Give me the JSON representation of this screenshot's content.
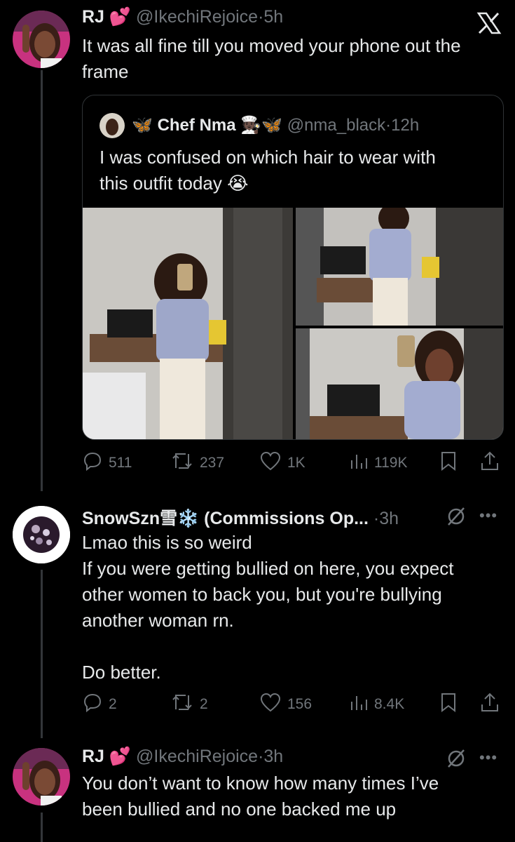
{
  "tweet1": {
    "name": "RJ",
    "name_emoji": "💕",
    "handle": "@IkechiRejoice",
    "sep": "·",
    "time": "5h",
    "text_line1": "It was all fine till you moved your phone out the",
    "text_line2": "frame",
    "x_logo_icon": "x-logo-icon",
    "quote": {
      "name": "Chef Nma",
      "handle": "@nma_black",
      "sep": "·",
      "time": "12h",
      "text_line1": "I was confused on which hair to wear with",
      "text_line2": "this outfit today 😭",
      "emojis_left": "🦋",
      "emojis_right": "🧑🏿‍🍳🦋"
    },
    "stats": {
      "replies": "511",
      "retweets": "237",
      "likes": "1K",
      "views": "119K"
    }
  },
  "tweet2": {
    "name": "SnowSzn雪❄️ (Commissions Op...",
    "sep": "·",
    "time": "3h",
    "text": [
      "Lmao this is so weird",
      "If you were getting bullied on here, you expect",
      "other women to back you, but you're bullying",
      "another woman rn.",
      "",
      "Do better."
    ],
    "stats": {
      "replies": "2",
      "retweets": "2",
      "likes": "156",
      "views": "8.4K"
    }
  },
  "tweet3": {
    "name": "RJ",
    "name_emoji": "💕",
    "handle": "@IkechiRejoice",
    "sep": "·",
    "time": "3h",
    "text_line1": "You don’t want to know how many times I’ve",
    "text_line2": "been bullied and no one backed me up"
  },
  "more_label": "•••",
  "colors": {
    "background": "#000000",
    "text": "#e7e9ea",
    "muted": "#71767b",
    "border": "#2f3336"
  }
}
